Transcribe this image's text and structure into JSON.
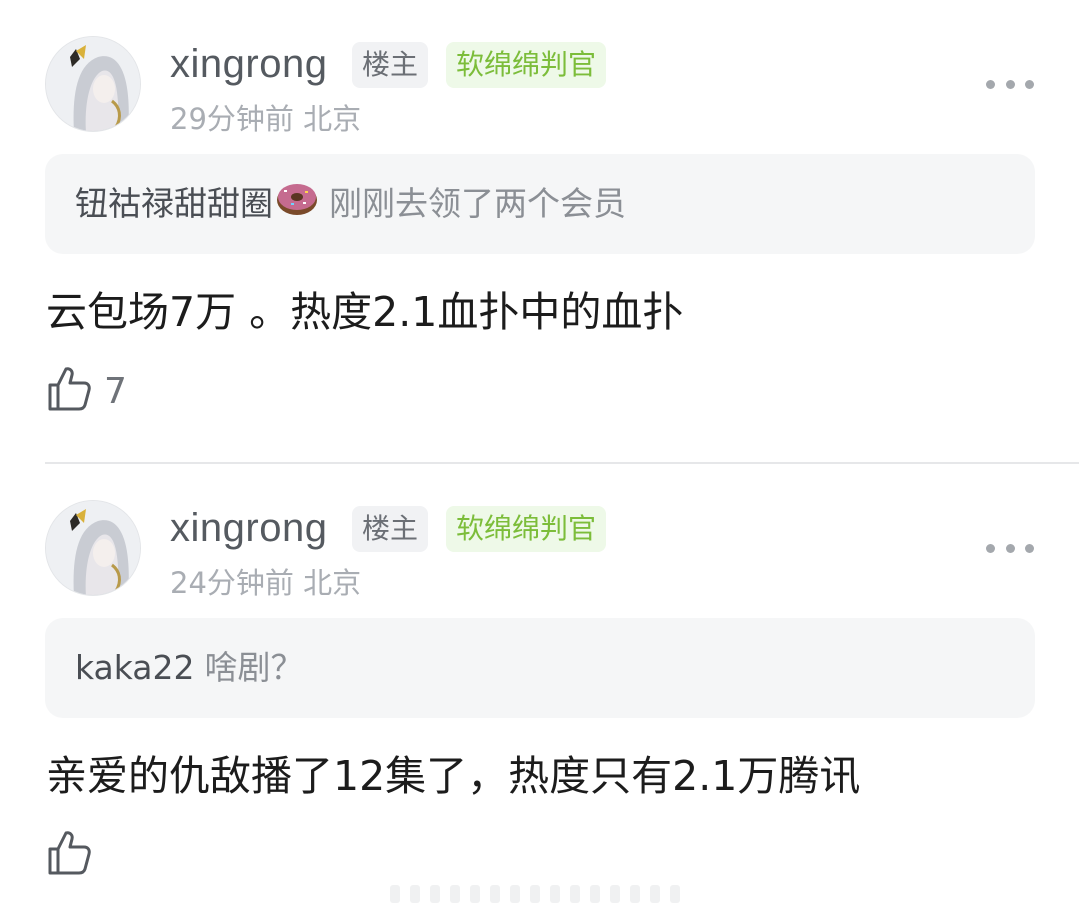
{
  "comments": [
    {
      "username": "xingrong",
      "op_badge": "楼主",
      "title_badge": "软绵绵判官",
      "meta": "29分钟前 北京",
      "quote": {
        "user": "钮祜禄甜甜圈",
        "text": "刚刚去领了两个会员"
      },
      "content": "云包场7万 。热度2.1血扑中的血扑",
      "likes": "7"
    },
    {
      "username": "xingrong",
      "op_badge": "楼主",
      "title_badge": "软绵绵判官",
      "meta": "24分钟前 北京",
      "quote": {
        "user": "kaka22",
        "text": "啥剧？"
      },
      "content": "亲爱的仇敌播了12集了，热度只有2.1万腾讯",
      "likes": ""
    }
  ],
  "icons": {
    "like": "thumbs-up-icon",
    "more": "more-icon",
    "emoji": "donut-icon"
  },
  "colors": {
    "title_badge": "#7cbd3a",
    "title_badge_bg": "#eef9e8",
    "quote_bg": "#f5f6f7",
    "meta": "#a9adb3"
  }
}
